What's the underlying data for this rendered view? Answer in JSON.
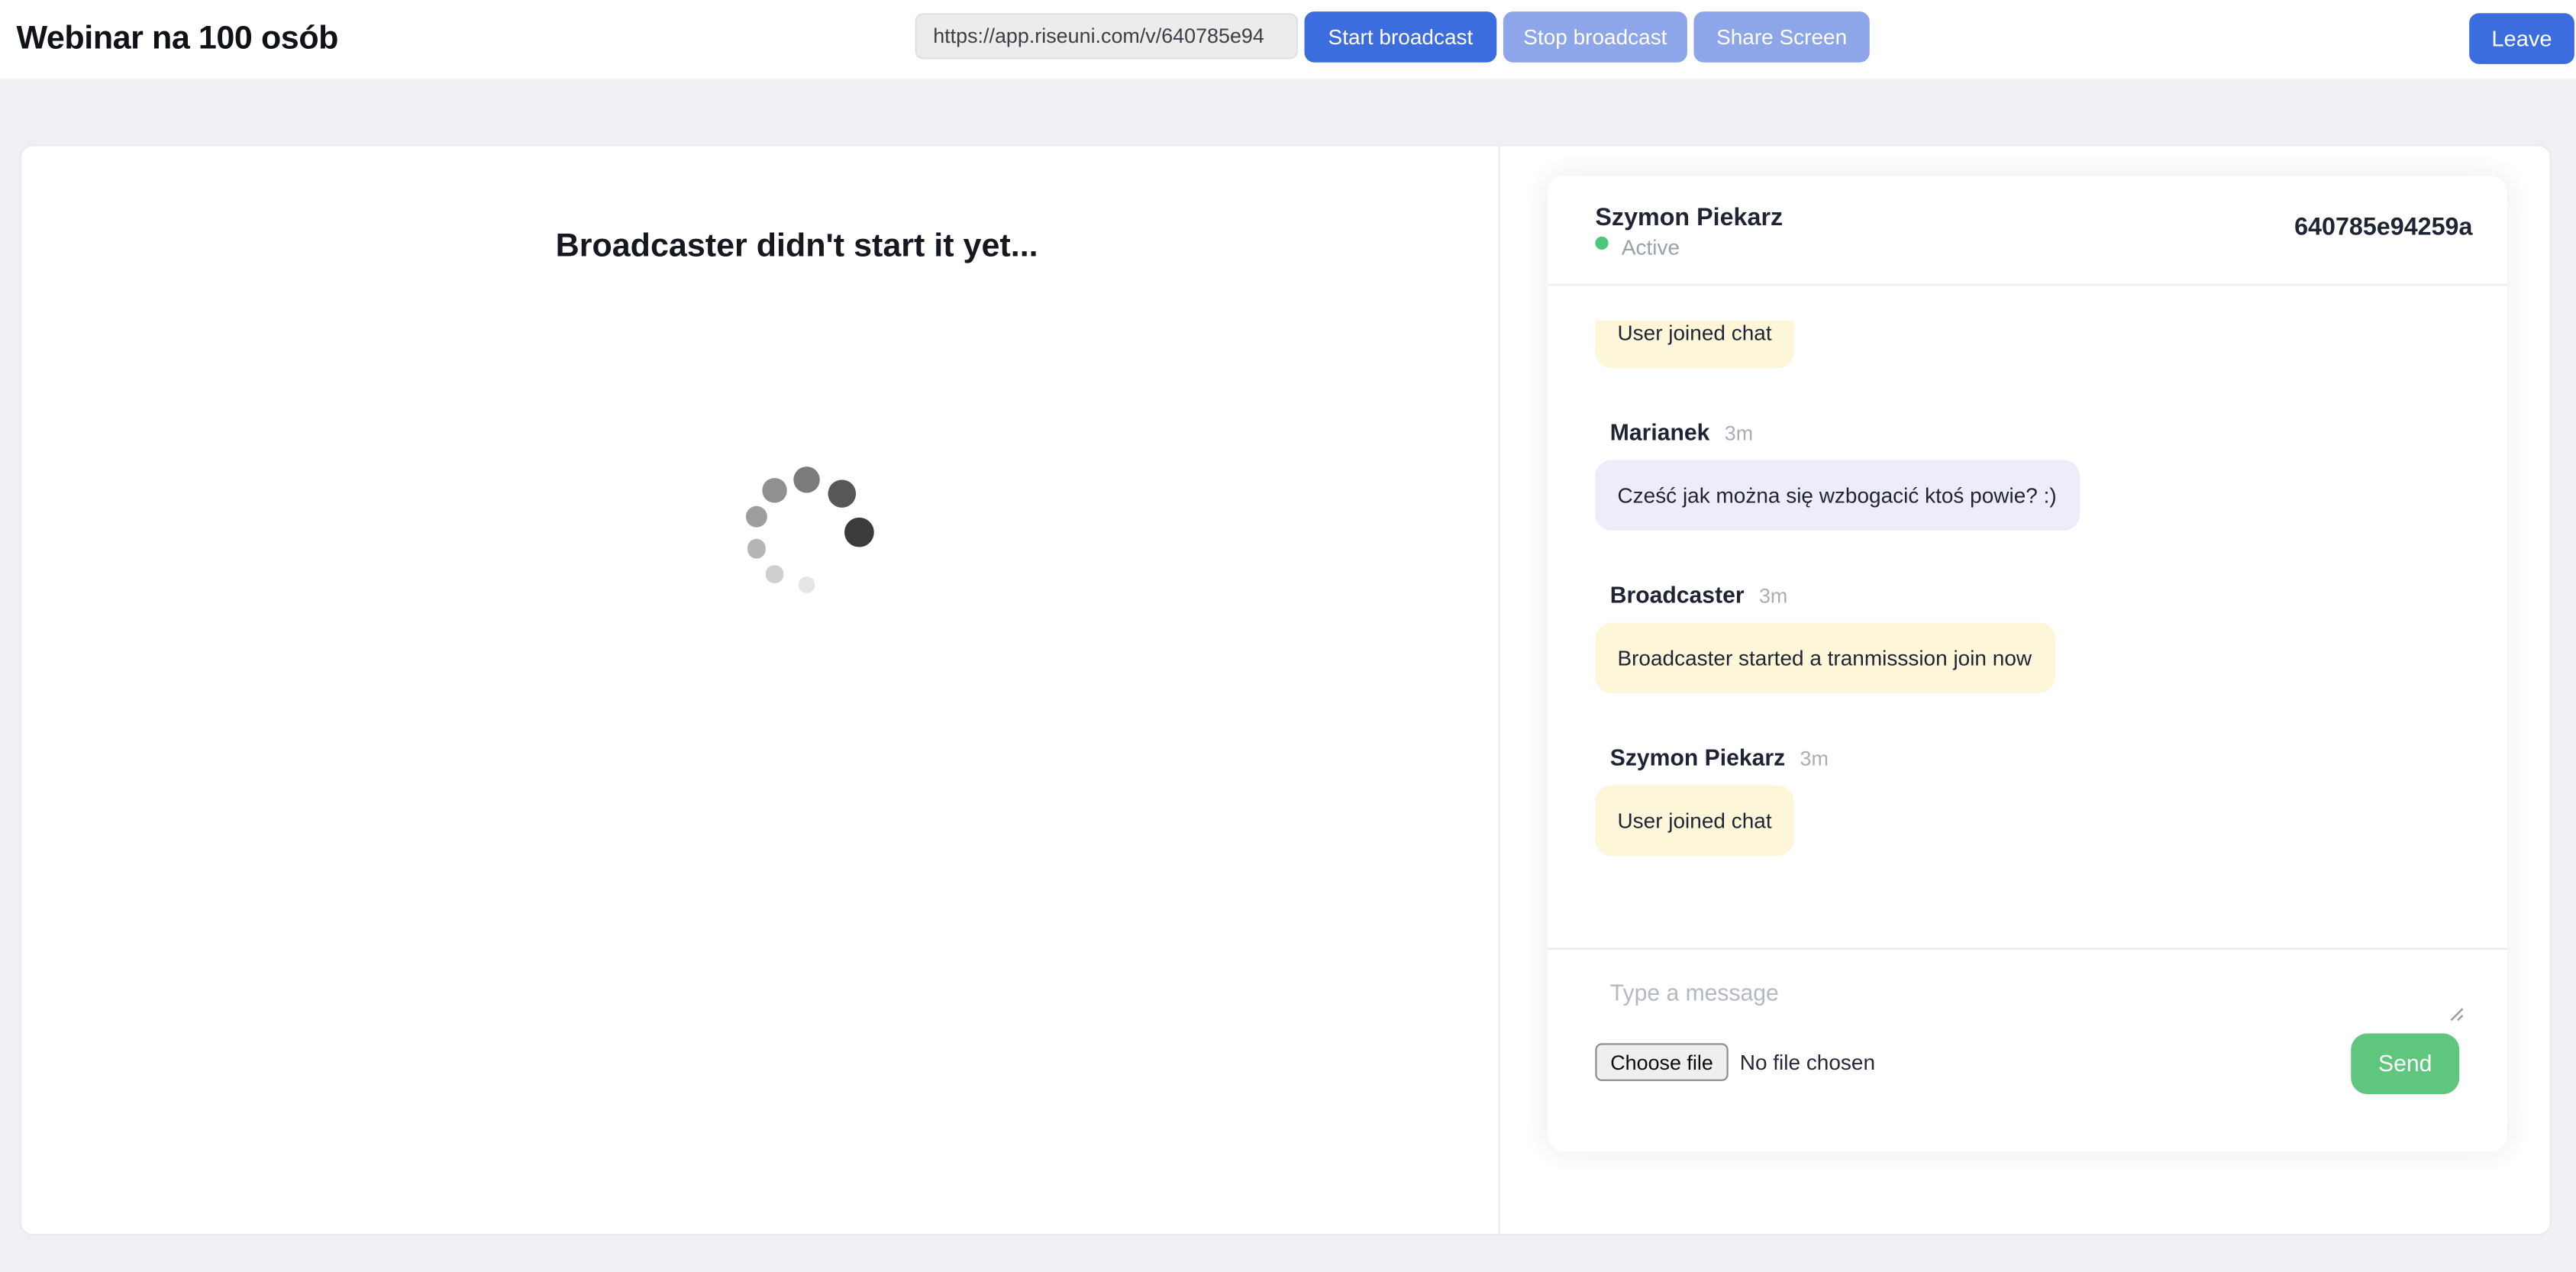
{
  "topbar": {
    "title": "Webinar na 100 osób",
    "share_url": "https://app.riseuni.com/v/640785e94",
    "start_broadcast_label": "Start broadcast",
    "stop_broadcast_label": "Stop broadcast",
    "share_screen_label": "Share Screen",
    "leave_label": "Leave"
  },
  "stage": {
    "heading": "Broadcaster didn't start it yet...",
    "spinner": {
      "ring_radius": 32,
      "dots": [
        {
          "deg": 0,
          "r": 9.3,
          "color": "#3b3b3b"
        },
        {
          "deg": 47,
          "r": 8.6,
          "color": "#575757"
        },
        {
          "deg": 90,
          "r": 8.0,
          "color": "#7b7b7b"
        },
        {
          "deg": 128,
          "r": 7.3,
          "color": "#909090"
        },
        {
          "deg": 163,
          "r": 6.7,
          "color": "#9e9e9e"
        },
        {
          "deg": 198,
          "r": 5.8,
          "color": "#b5b5b5"
        },
        {
          "deg": 232,
          "r": 5.3,
          "color": "#cfcfcf"
        },
        {
          "deg": 270,
          "r": 4.8,
          "color": "#e5e5e5"
        }
      ]
    }
  },
  "chat": {
    "header": {
      "name": "Szymon Piekarz",
      "status": "Active",
      "room_id": "640785e94259a"
    },
    "messages": [
      {
        "author": "",
        "time": "",
        "text": "User joined chat",
        "style": "cream",
        "clipped": true
      },
      {
        "author": "Marianek",
        "time": "3m",
        "text": "Cześć jak można się wzbogacić ktoś powie? :)",
        "style": "lavender",
        "clipped": false
      },
      {
        "author": "Broadcaster",
        "time": "3m",
        "text": "Broadcaster started a tranmisssion join now",
        "style": "cream",
        "clipped": false
      },
      {
        "author": "Szymon Piekarz",
        "time": "3m",
        "text": "User joined chat",
        "style": "cream",
        "clipped": false
      }
    ],
    "composer": {
      "placeholder": "Type a message",
      "choose_file_label": "Choose file",
      "no_file_text": "No file chosen",
      "send_label": "Send"
    }
  },
  "colors": {
    "primary_blue": "#3b6dde",
    "disabled_blue": "#8da6ea",
    "send_green": "#5fc67d",
    "active_dot_green": "#4bc77c",
    "bubble_cream": "#fdf6d9",
    "bubble_lavender": "#efecfa",
    "text_dark": "#1e2433",
    "text_gray": "#9aa1ad",
    "page_background": "#eef0f4"
  }
}
